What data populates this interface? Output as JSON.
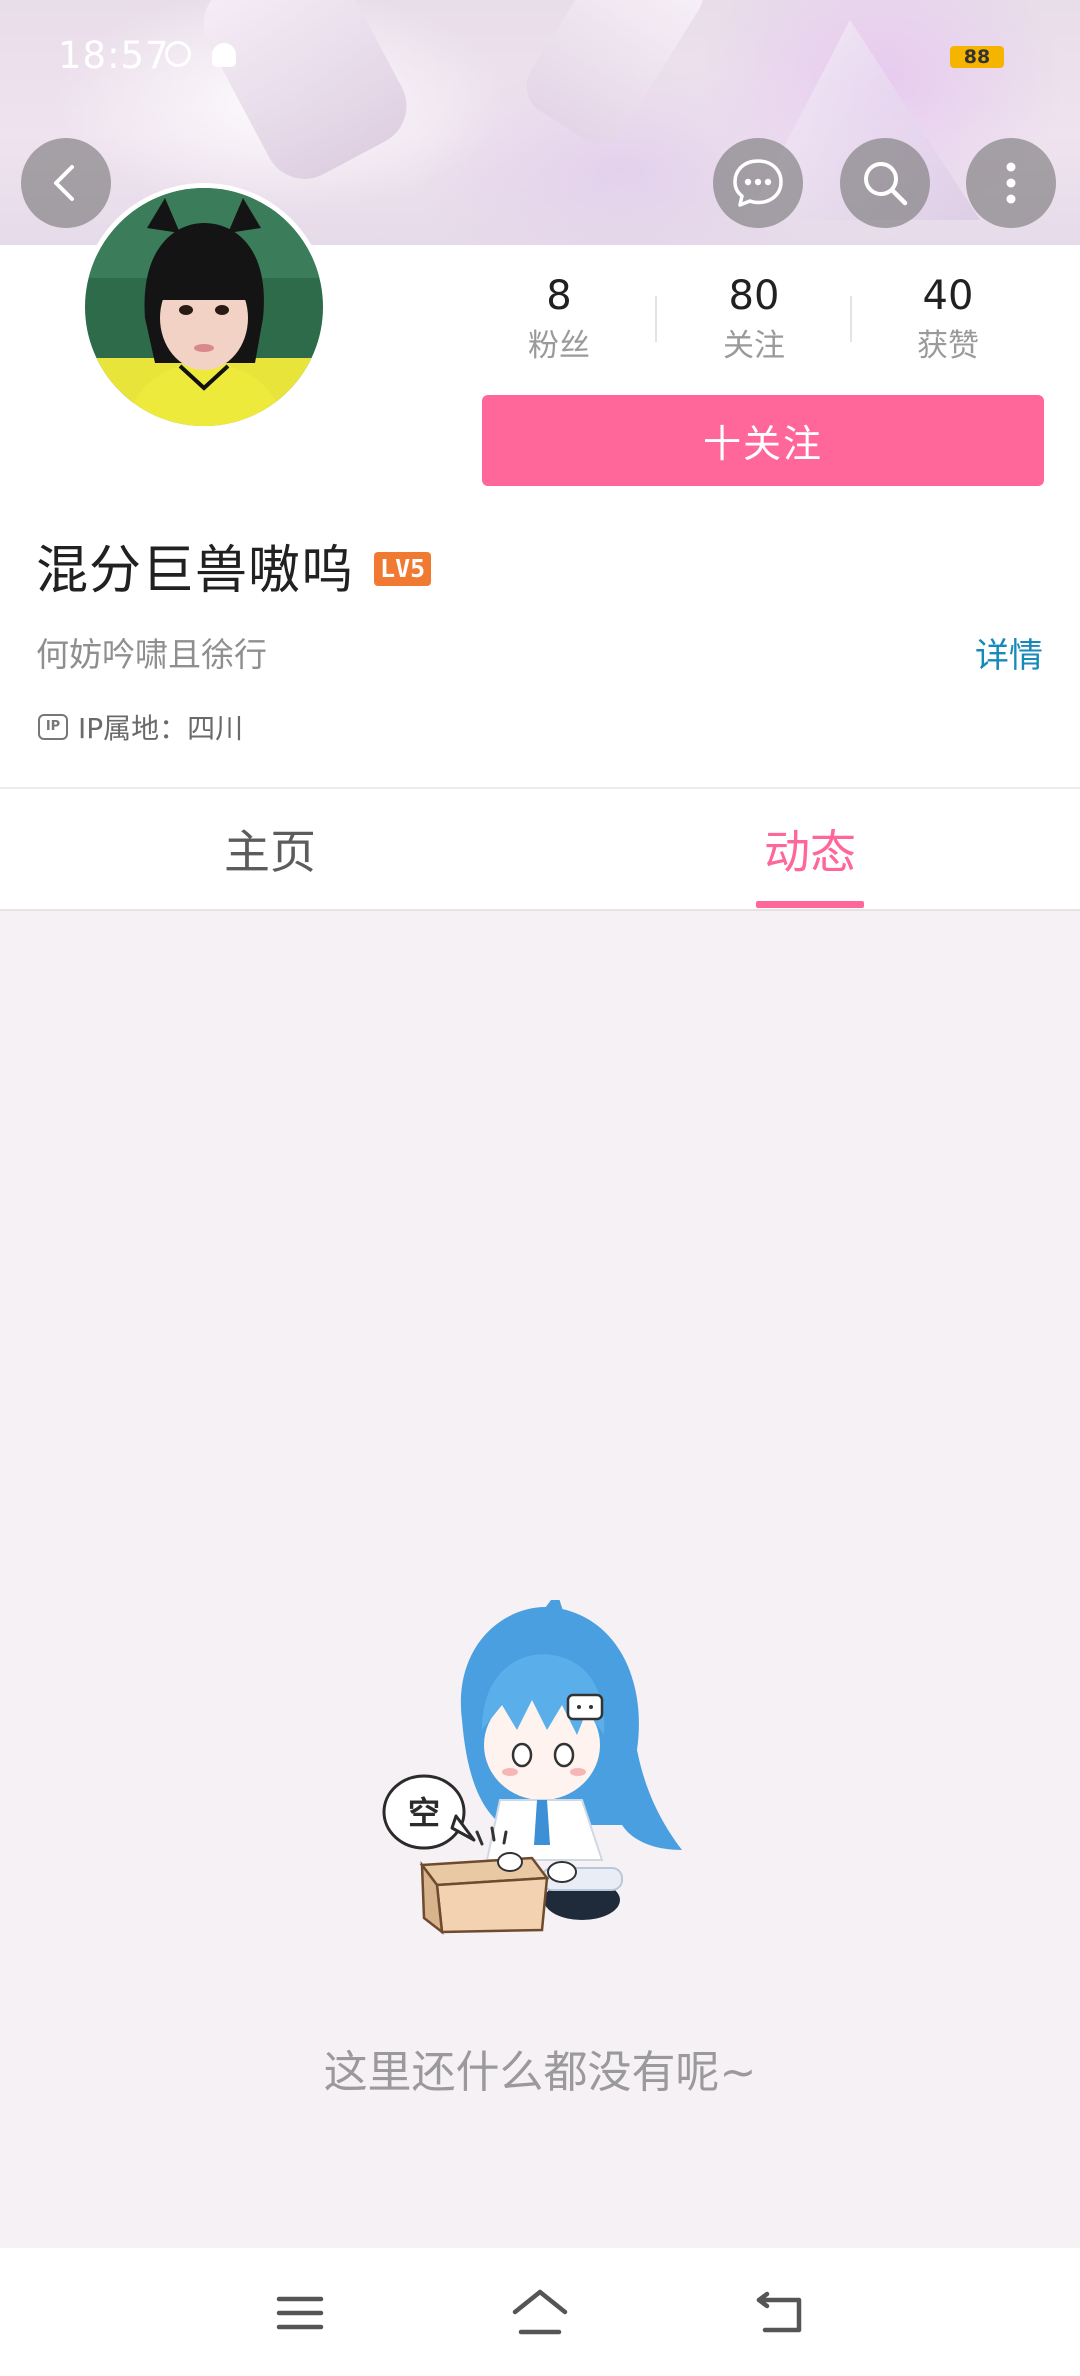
{
  "status_bar": {
    "time": "18:57",
    "battery": "88"
  },
  "header": {
    "back_icon": "chevron-left-icon",
    "message_icon": "message-icon",
    "search_icon": "search-icon",
    "more_icon": "more-vertical-icon"
  },
  "profile": {
    "avatar_icon": "avatar",
    "stats": [
      {
        "value": "8",
        "label": "粉丝"
      },
      {
        "value": "80",
        "label": "关注"
      },
      {
        "value": "40",
        "label": "获赞"
      }
    ],
    "follow_button": "十关注",
    "username": "混分巨兽嗷呜",
    "level": "LV5",
    "signature": "何妨吟啸且徐行",
    "details_link": "详情",
    "ip_icon_text": "IP",
    "ip_location": "IP属地：四川"
  },
  "tabs": [
    {
      "label": "主页",
      "active": false
    },
    {
      "label": "动态",
      "active": true
    }
  ],
  "empty_state": {
    "bubble_text": "空",
    "message": "这里还什么都没有呢~"
  },
  "nav_bar": {
    "menu_icon": "menu-icon",
    "home_icon": "home-icon",
    "back_icon": "back-icon"
  },
  "colors": {
    "accent": "#ff6699",
    "link": "#168ab8",
    "level_badge": "#f07a32"
  }
}
